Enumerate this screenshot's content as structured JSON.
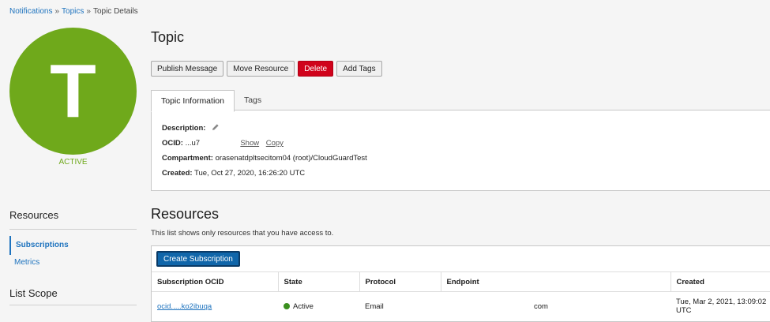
{
  "breadcrumb": {
    "items": [
      "Notifications",
      "Topics",
      "Topic Details"
    ],
    "separator": "»"
  },
  "avatar": {
    "letter": "T",
    "state": "ACTIVE",
    "color": "#6fa91b"
  },
  "page": {
    "title": "Topic"
  },
  "toolbar": {
    "publish": "Publish Message",
    "move": "Move Resource",
    "delete": "Delete",
    "add_tags": "Add Tags"
  },
  "tabs": {
    "info": "Topic Information",
    "tags": "Tags"
  },
  "info": {
    "description_label": "Description:",
    "ocid_label": "OCID:",
    "ocid_value": "...u7",
    "ocid_show": "Show",
    "ocid_copy": "Copy",
    "compartment_label": "Compartment:",
    "compartment_value": "orasenatdpltsecitom04 (root)/CloudGuardTest",
    "created_label": "Created:",
    "created_value": "Tue, Oct 27, 2020, 16:26:20 UTC"
  },
  "sidebar": {
    "resources_title": "Resources",
    "items": [
      "Subscriptions",
      "Metrics"
    ],
    "list_scope_title": "List Scope"
  },
  "resources": {
    "title": "Resources",
    "note": "This list shows only resources that you have access to.",
    "create_button": "Create Subscription",
    "columns": [
      "Subscription OCID",
      "State",
      "Protocol",
      "Endpoint",
      "Created"
    ],
    "rows": [
      {
        "ocid": "ocid.....ko2ibuqa",
        "state": "Active",
        "protocol": "Email",
        "endpoint": "com",
        "created_line1": "Tue, Mar 2, 2021, 13:09:02",
        "created_line2": "UTC"
      }
    ]
  },
  "colors": {
    "accent": "#1e73be",
    "danger": "#d0021b",
    "primary": "#1066aa",
    "active": "#3a8f1e"
  }
}
